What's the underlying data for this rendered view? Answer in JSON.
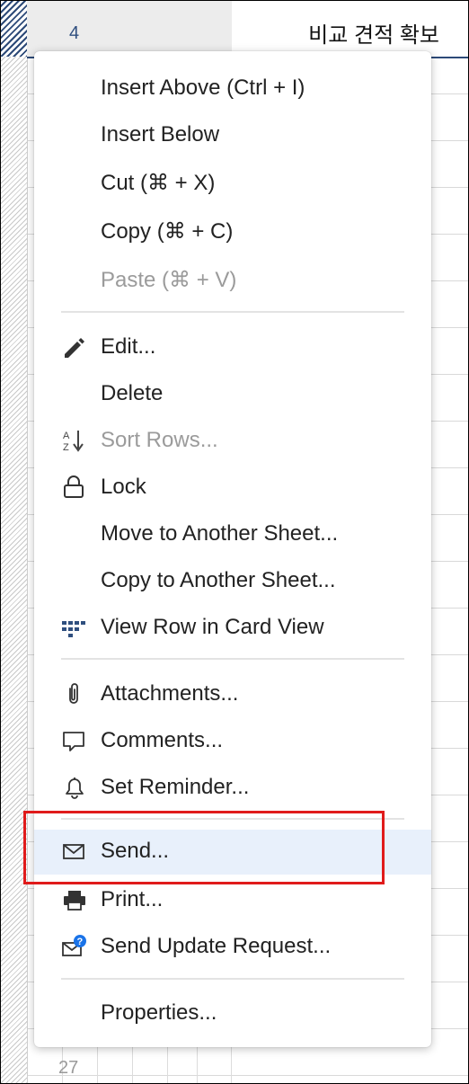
{
  "sheet": {
    "top_row_number": "4",
    "top_row_title": "비교 견적 확보",
    "bottom_row_number": "27"
  },
  "menu": {
    "insert_above": "Insert Above (Ctrl + I)",
    "insert_below": "Insert Below",
    "cut": "Cut (⌘ + X)",
    "copy": "Copy (⌘ + C)",
    "paste": "Paste (⌘ + V)",
    "edit": "Edit...",
    "delete": "Delete",
    "sort_rows": "Sort Rows...",
    "lock": "Lock",
    "move_to_sheet": "Move to Another Sheet...",
    "copy_to_sheet": "Copy to Another Sheet...",
    "card_view": "View Row in Card View",
    "attachments": "Attachments...",
    "comments": "Comments...",
    "set_reminder": "Set Reminder...",
    "send": "Send...",
    "print": "Print...",
    "send_update": "Send Update Request...",
    "properties": "Properties..."
  },
  "colors": {
    "highlight": "#e8f0fb",
    "annotation_box": "#e01b1b",
    "badge": "#1a73e8"
  }
}
